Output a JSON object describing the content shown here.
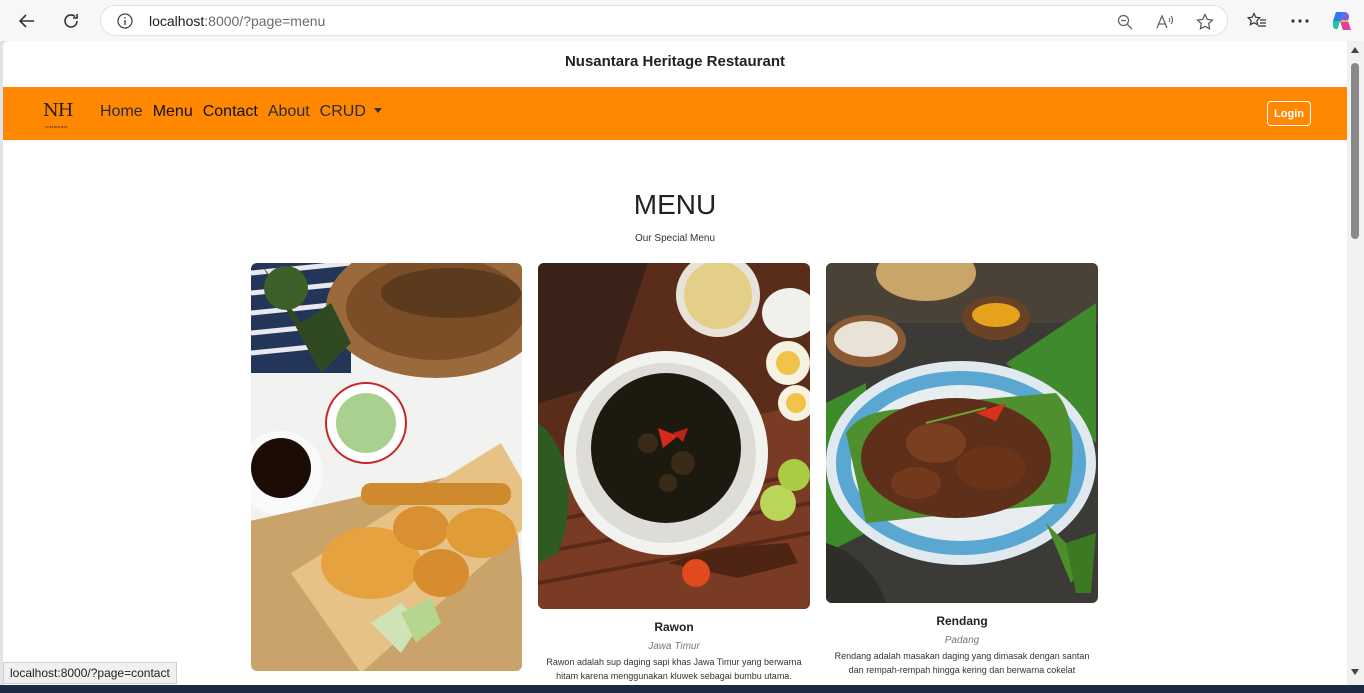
{
  "browser": {
    "url_host": "localhost",
    "url_rest": ":8000/?page=menu",
    "status_url": "localhost:8000/?page=contact"
  },
  "site": {
    "title": "Nusantara Heritage Restaurant",
    "logo_main": "NH",
    "logo_sub": "restaurant"
  },
  "nav": {
    "items": [
      {
        "label": "Home"
      },
      {
        "label": "Menu"
      },
      {
        "label": "Contact"
      },
      {
        "label": "About"
      },
      {
        "label": "CRUD"
      }
    ],
    "login_label": "Login"
  },
  "menu": {
    "heading": "MENU",
    "subheading": "Our Special Menu",
    "cards": [
      {
        "title": "",
        "origin": "",
        "description": ""
      },
      {
        "title": "Rawon",
        "origin": "Jawa Timur",
        "description": "Rawon adalah sup daging sapi khas Jawa Timur yang berwarna hitam karena menggunakan kluwek sebagai bumbu utama."
      },
      {
        "title": "Rendang",
        "origin": "Padang",
        "description": "Rendang adalah masakan daging yang dimasak dengan santan dan rempah-rempah hingga kering dan berwarna cokelat"
      }
    ]
  },
  "colors": {
    "navbar": "#ff8800",
    "accent": "#ff8800"
  }
}
